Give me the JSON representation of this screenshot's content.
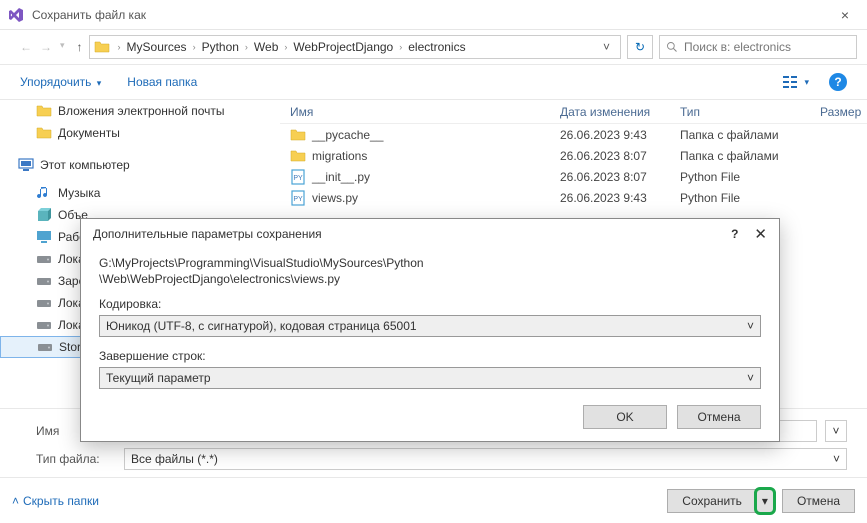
{
  "window": {
    "title": "Сохранить файл как",
    "close_glyph": "×"
  },
  "nav": {
    "back_glyph": "←",
    "fwd_glyph": "→",
    "up_glyph": "↑",
    "breadcrumb": [
      "MySources",
      "Python",
      "Web",
      "WebProjectDjango",
      "electronics"
    ],
    "sep_glyph": "›",
    "caret_glyph": "˅",
    "refresh_glyph": "↻",
    "search_placeholder": "Поиск в: electronics"
  },
  "toolbar": {
    "organize": "Упорядочить",
    "newfolder": "Новая папка",
    "caret": "▾",
    "help": "?",
    "view_caret": "▾"
  },
  "sidebar": {
    "items": [
      {
        "label": "Вложения электронной почты",
        "icon": "folder"
      },
      {
        "label": "Документы",
        "icon": "folder"
      }
    ],
    "this_pc": "Этот компьютер",
    "music": "Музыка",
    "rest": [
      "Объе",
      "Рабо",
      "Лока",
      "Зарез",
      "Лока",
      "Лока",
      "Storaç"
    ]
  },
  "files": {
    "headers": {
      "name": "Имя",
      "date": "Дата изменения",
      "type": "Тип",
      "size": "Размер"
    },
    "rows": [
      {
        "name": "__pycache__",
        "date": "26.06.2023 9:43",
        "type": "Папка с файлами",
        "kind": "folder"
      },
      {
        "name": "migrations",
        "date": "26.06.2023 8:07",
        "type": "Папка с файлами",
        "kind": "folder"
      },
      {
        "name": "__init__.py",
        "date": "26.06.2023 8:07",
        "type": "Python File",
        "kind": "py"
      },
      {
        "name": "views.py",
        "date": "26.06.2023 9:43",
        "type": "Python File",
        "kind": "py"
      }
    ]
  },
  "fields": {
    "filename_label": "Имя",
    "filetype_label": "Тип файла:",
    "filetype_value": "Все файлы (*.*)",
    "history_glyph": "˅",
    "filetype_caret": "˅"
  },
  "footer": {
    "hide": "Скрыть папки",
    "caret_up": "˄",
    "save": "Сохранить",
    "save_caret": "▾",
    "cancel": "Отмена"
  },
  "subdialog": {
    "title": "Дополнительные параметры сохранения",
    "help": "?",
    "close": "✕",
    "path_line1": "G:\\MyProjects\\Programming\\VisualStudio\\MySources\\Python",
    "path_line2": "\\Web\\WebProjectDjango\\electronics\\views.py",
    "encoding_label": "Кодировка:",
    "encoding_value": "Юникод (UTF-8, с сигнатурой), кодовая страница 65001",
    "lineending_label": "Завершение строк:",
    "lineending_value": "Текущий параметр",
    "caret": "˅",
    "ok": "OK",
    "cancel": "Отмена"
  }
}
